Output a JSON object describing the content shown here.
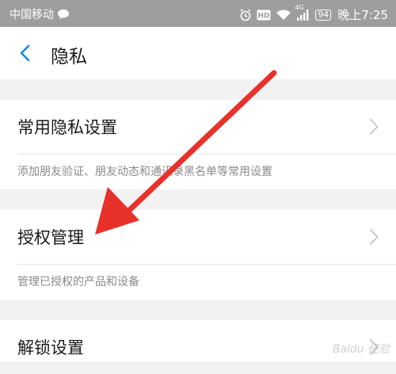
{
  "status_bar": {
    "carrier": "中国移动",
    "network": "4G",
    "battery": "94",
    "time": "晚上7:25"
  },
  "header": {
    "title": "隐私"
  },
  "sections": [
    {
      "label": "常用隐私设置",
      "description": "添加朋友验证、朋友动态和通讯录黑名单等常用设置"
    },
    {
      "label": "授权管理",
      "description": "管理已授权的产品和设备"
    },
    {
      "label": "解锁设置"
    }
  ],
  "watermark": "Baidu 经验",
  "colors": {
    "status_bar": "#9e9e9e",
    "accent": "#1a88e0",
    "arrow": "#e8312a",
    "background": "#f2f2f2"
  },
  "icons": [
    "back-icon",
    "chevron-right-icon",
    "message-icon",
    "alarm-icon",
    "hd-icon",
    "wifi-icon",
    "signal-icon"
  ]
}
